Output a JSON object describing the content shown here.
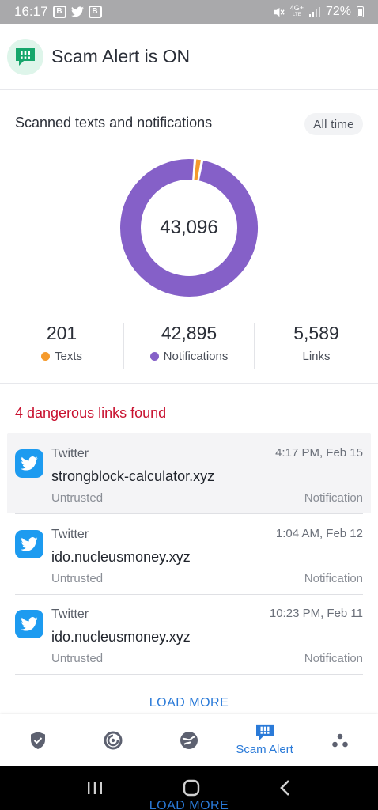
{
  "status_bar": {
    "time": "16:17",
    "left_icons": [
      "notification-box-icon",
      "twitter-icon",
      "b-box-icon"
    ],
    "notif_box_glyph": "B",
    "b_box_glyph": "B",
    "network_top": "4G+",
    "network_bottom": "LTE",
    "battery": "72%"
  },
  "header": {
    "title": "Scam Alert is ON",
    "logo_icon": "alert-message-icon",
    "logo_color": "#16a66b",
    "logo_bg": "#def5ea"
  },
  "summary": {
    "title": "Scanned texts and notifications",
    "range": "All time",
    "total": "43,096",
    "stats": [
      {
        "value": "201",
        "label": "Texts",
        "color": "#f59a2c",
        "has_dot": true
      },
      {
        "value": "42,895",
        "label": "Notifications",
        "color": "#8560c8",
        "has_dot": true
      },
      {
        "value": "5,589",
        "label": "Links",
        "has_dot": false
      }
    ]
  },
  "chart_data": {
    "type": "pie",
    "variant": "donut",
    "center_label": "43,096",
    "slices": [
      {
        "name": "Texts",
        "value": 201,
        "color": "#f59a2c"
      },
      {
        "name": "Notifications",
        "value": 42895,
        "color": "#8560c8"
      }
    ]
  },
  "alerts_title": "4 dangerous links found",
  "alerts": [
    {
      "source": "Twitter",
      "time": "4:17 PM, Feb 15",
      "domain": "strongblock-calculator.xyz",
      "trust": "Untrusted",
      "kind": "Notification",
      "icon": "twitter-icon",
      "highlighted": true
    },
    {
      "source": "Twitter",
      "time": "1:04 AM, Feb 12",
      "domain": "ido.nucleusmoney.xyz",
      "trust": "Untrusted",
      "kind": "Notification",
      "icon": "twitter-icon",
      "highlighted": false
    },
    {
      "source": "Twitter",
      "time": "10:23 PM, Feb 11",
      "domain": "ido.nucleusmoney.xyz",
      "trust": "Untrusted",
      "kind": "Notification",
      "icon": "twitter-icon",
      "highlighted": false
    }
  ],
  "load_more": "LOAD MORE",
  "bottom_nav": {
    "items": [
      {
        "icon": "shield-check-icon",
        "label": ""
      },
      {
        "icon": "security-check-icon",
        "label": ""
      },
      {
        "icon": "web-protection-icon",
        "label": ""
      },
      {
        "icon": "scam-alert-icon",
        "label": "Scam Alert",
        "active": true
      },
      {
        "icon": "more-dots-icon",
        "label": ""
      }
    ]
  },
  "system_nav": [
    "recents-icon",
    "home-icon",
    "back-icon"
  ],
  "colors": {
    "accent": "#2a7ad8",
    "danger": "#c8102e",
    "texts": "#f59a2c",
    "notifications": "#8560c8",
    "twitter": "#1d9bf0"
  }
}
